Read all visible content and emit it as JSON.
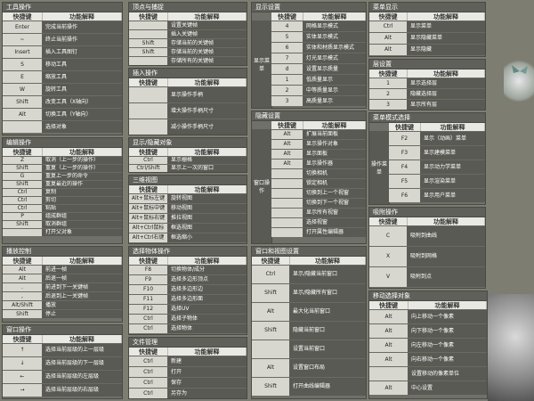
{
  "panels": [
    {
      "id": "tools",
      "title": "工具操作",
      "hdr": [
        "快捷键",
        "功能解释"
      ],
      "rows": [
        [
          "Enter",
          "完成当前操作"
        ],
        [
          "~",
          "终止当前操作"
        ],
        [
          "Insert",
          "插入工具图钉"
        ],
        [
          "S",
          "移动工具"
        ],
        [
          "E",
          "缩放工具"
        ],
        [
          "W",
          "旋转工具"
        ],
        [
          "Shift",
          "改变工具（X轴向）"
        ],
        [
          "Alt",
          "切换工具（Y轴向）"
        ],
        [
          "",
          "选择对象"
        ]
      ]
    },
    {
      "id": "snap",
      "title": "顶点与捕捉",
      "hdr": [
        "快捷键",
        "功能解释"
      ],
      "rows": [
        [
          "",
          "设置关键帧"
        ],
        [
          "",
          "插入关键帧"
        ],
        [
          "Shift",
          "存储当前的关键帧"
        ],
        [
          "Shift",
          "存储当前的关键帧"
        ],
        [
          "",
          "存储所有的关键帧"
        ]
      ]
    },
    {
      "id": "insert",
      "title": "插入操作",
      "hdr": [
        "快捷键",
        "功能解释"
      ],
      "rows": [
        [
          "",
          "显示操作手柄"
        ],
        [
          "",
          "增大操作手柄尺寸"
        ],
        [
          "",
          "减小操作手柄尺寸"
        ]
      ]
    },
    {
      "id": "edit",
      "title": "编辑操作",
      "hdr": [
        "快捷键",
        "功能解释"
      ],
      "rows": [
        [
          "Z",
          "取消（上一步的操作）"
        ],
        [
          "Shift",
          "重复（上一步的操作）"
        ],
        [
          "G",
          "重复上一步的命令"
        ],
        [
          "Shift",
          "重复最近的操作"
        ],
        [
          "Ctrl",
          "复制"
        ],
        [
          "Ctrl",
          "剪切"
        ],
        [
          "Ctrl",
          "粘贴"
        ],
        [
          "P",
          "组成群组"
        ],
        [
          "Shift",
          "取消群组"
        ],
        [
          "",
          "打开父对象"
        ]
      ]
    },
    {
      "id": "display",
      "title": "显示/隐藏对象",
      "hdr": [
        "快捷键",
        "功能解释"
      ],
      "rows": [
        [
          "Ctrl",
          "显示栅格"
        ],
        [
          "Ctrl/Shift",
          "显示上一次的窗口"
        ]
      ]
    },
    {
      "id": "three",
      "title": "三维视图",
      "hdr": [
        "快捷键",
        "功能解释"
      ],
      "rows": [
        [
          "Alt+鼠标左键",
          "旋转视图"
        ],
        [
          "Alt+鼠标中键",
          "移动视图"
        ],
        [
          "Alt+鼠标右键",
          "推拉视图"
        ],
        [
          "Alt+Ctrl鼠标",
          "框选视图"
        ],
        [
          "Alt+Ctrl右键",
          "框选缩小"
        ]
      ]
    },
    {
      "id": "anim",
      "title": "播放控制",
      "hdr": [
        "快捷键",
        "功能解释"
      ],
      "rows": [
        [
          "Alt",
          "前进一帧"
        ],
        [
          "Alt",
          "后退一帧"
        ],
        [
          ".",
          "前进到下一关键帧"
        ],
        [
          ",",
          "后退到上一关键帧"
        ],
        [
          "Alt/Shift",
          "播放"
        ],
        [
          "Shift",
          "停止"
        ]
      ]
    },
    {
      "id": "sel",
      "title": "选择物体操作",
      "hdr": [
        "快捷键",
        "功能解释"
      ],
      "rows": [
        [
          "F8",
          "切换物体/成分"
        ],
        [
          "F9",
          "选择多边形顶点"
        ],
        [
          "F10",
          "选择多边形边"
        ],
        [
          "F11",
          "选择多边形面"
        ],
        [
          "F12",
          "选择UV"
        ],
        [
          "Ctrl",
          "选择子物体"
        ],
        [
          "Ctrl",
          "选择物体"
        ]
      ]
    },
    {
      "id": "win",
      "title": "窗口操作",
      "hdr": [
        "快捷键",
        "功能解释"
      ],
      "rows": [
        [
          "↑",
          "选择当前层级的上一层级"
        ],
        [
          "↓",
          "选择当前层级的下一层级"
        ],
        [
          "←",
          "选择当前层级的左层级"
        ],
        [
          "→",
          "选择当前层级的右层级"
        ]
      ]
    },
    {
      "id": "file",
      "title": "文件管理",
      "hdr": [
        "快捷键",
        "功能解释"
      ],
      "rows": [
        [
          "Ctrl",
          "新建"
        ],
        [
          "Ctrl",
          "打开"
        ],
        [
          "Ctrl",
          "保存"
        ],
        [
          "Ctrl",
          "另存为"
        ]
      ]
    },
    {
      "id": "dispset",
      "title": "显示设置",
      "grp": "显示菜单",
      "hdr": [
        "快捷键",
        "功能解释"
      ],
      "rows": [
        [
          "4",
          "网格显示模式"
        ],
        [
          "5",
          "实体显示模式"
        ],
        [
          "6",
          "实体和材质显示模式"
        ],
        [
          "7",
          "灯光显示模式"
        ],
        [
          "d",
          "设置显示质量"
        ],
        [
          "1",
          "低质量显示"
        ],
        [
          "2",
          "中等质量显示"
        ],
        [
          "3",
          "高质量显示"
        ]
      ]
    },
    {
      "id": "menuvis",
      "title": "菜单显示",
      "hdr": [
        "快捷键",
        "功能解释"
      ],
      "rows": [
        [
          "Ctrl",
          "显示菜单"
        ],
        [
          "Alt",
          "显示隐藏菜单"
        ],
        [
          "Alt",
          "显示隐藏"
        ]
      ]
    },
    {
      "id": "layer",
      "title": "层设置",
      "hdr": [
        "快捷键",
        "功能解释"
      ],
      "rows": [
        [
          "1",
          "显示选择层"
        ],
        [
          "2",
          "隐藏选择层"
        ],
        [
          "3",
          "显示所有层"
        ]
      ]
    },
    {
      "id": "hide",
      "title": "隐藏设置",
      "grp": "窗口操作",
      "hdr": [
        "快捷键",
        "功能解释"
      ],
      "rows": [
        [
          "Alt",
          "扩展当前面板"
        ],
        [
          "Alt",
          "显示操作对象"
        ],
        [
          "Alt",
          "显示面板"
        ],
        [
          "Alt",
          "显示操作器"
        ],
        [
          "",
          "切换相机"
        ],
        [
          "",
          "锁定相机"
        ],
        [
          "",
          "切换到上一个视窗"
        ],
        [
          "",
          "切换到下一个视窗"
        ],
        [
          "",
          "显示所有视窗"
        ],
        [
          "",
          "选择视窗"
        ],
        [
          "",
          "打开属性编辑器"
        ]
      ]
    },
    {
      "id": "key",
      "title": "菜单模式选择",
      "grp": "操作菜单",
      "hdr": [
        "快捷键",
        "功能解释"
      ],
      "rows": [
        [
          "F2",
          "显示（动画）菜单"
        ],
        [
          "F3",
          "显示建模菜单"
        ],
        [
          "F4",
          "显示动力学菜单"
        ],
        [
          "F5",
          "显示渲染菜单"
        ],
        [
          "F6",
          "显示用户菜单"
        ]
      ]
    },
    {
      "id": "snap2",
      "title": "吸附操作",
      "hdr": [
        "快捷键",
        "功能解释"
      ],
      "rows": [
        [
          "C",
          "吸附到曲线"
        ],
        [
          "X",
          "吸附到网格"
        ],
        [
          "V",
          "吸附到点"
        ]
      ]
    },
    {
      "id": "winc",
      "title": "窗口和视图设置",
      "hdr": [
        "快捷键",
        "功能解释"
      ],
      "rows": [
        [
          "Ctrl",
          "显示/隐藏当前窗口"
        ],
        [
          "Shift",
          "显示/隐藏所有窗口"
        ],
        [
          "Alt",
          "最大化当前窗口"
        ],
        [
          "Shift",
          "隐藏当前窗口"
        ],
        [
          "",
          "设置当前窗口"
        ],
        [
          "Alt",
          "设置窗口布局"
        ],
        [
          "Shift",
          "打开曲线编辑器"
        ]
      ]
    },
    {
      "id": "movesel",
      "title": "移动选择对象",
      "hdr": [
        "快捷键",
        "功能解释"
      ],
      "rows": [
        [
          "Alt",
          "向上移动一个像素"
        ],
        [
          "Alt",
          "向下移动一个像素"
        ],
        [
          "Alt",
          "向左移动一个像素"
        ],
        [
          "Alt",
          "向右移动一个像素"
        ],
        [
          "",
          "设置移动的像素单位"
        ],
        [
          "Alt",
          "中心设置"
        ]
      ]
    }
  ]
}
